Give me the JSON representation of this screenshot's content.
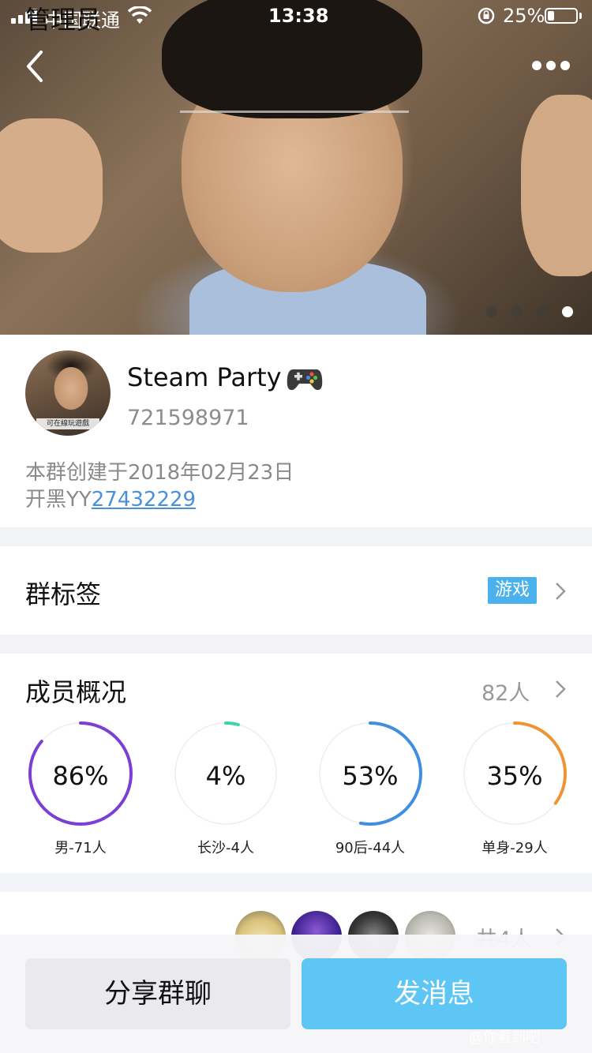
{
  "status_bar": {
    "carrier": "中国联通",
    "time": "13:38",
    "battery": "25%"
  },
  "hero": {
    "page_count": 4,
    "active_page": 4
  },
  "group": {
    "name": "Steam Party",
    "id": "721598971",
    "avatar_caption": "可在線玩遊戲",
    "created": "本群创建于2018年02月23日",
    "yy_prefix": "开黑YY",
    "yy_number": "27432229"
  },
  "tags": {
    "title": "群标签",
    "tag": "游戏"
  },
  "members": {
    "title": "成员概况",
    "count": "82人",
    "stats": [
      {
        "pct": "86%",
        "value": 0.86,
        "label": "男-71人",
        "color": "#7b3fd6"
      },
      {
        "pct": "4%",
        "value": 0.04,
        "label": "长沙-4人",
        "color": "#3ed2b2"
      },
      {
        "pct": "53%",
        "value": 0.53,
        "label": "90后-44人",
        "color": "#3f8ee0"
      },
      {
        "pct": "35%",
        "value": 0.35,
        "label": "单身-29人",
        "color": "#ef9434"
      }
    ]
  },
  "admins": {
    "title": "管理员",
    "count": "共4人"
  },
  "actions": {
    "share": "分享群聊",
    "send": "发消息"
  },
  "watermark": "@你看到吧"
}
